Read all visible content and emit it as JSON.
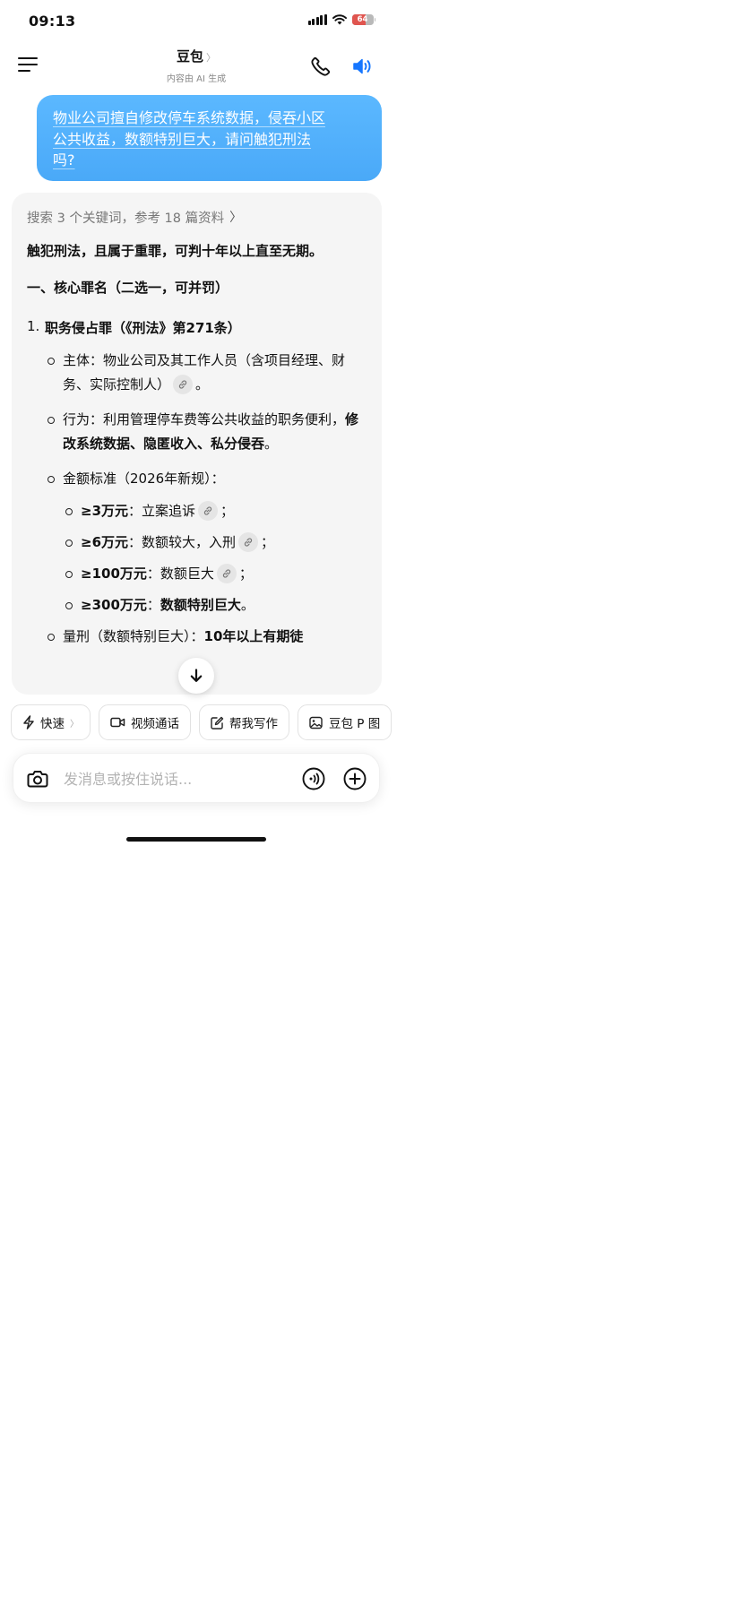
{
  "status_bar": {
    "time": "09:13",
    "battery_text": "64",
    "battery_level": 0.64
  },
  "header": {
    "title": "豆包",
    "subtitle": "内容由 AI 生成"
  },
  "user_message": {
    "line1": "物业公司擅自修改停车系统数据，侵吞小区",
    "line2": "公共收益，数额特别巨大，请问触犯刑法",
    "line3": "吗?"
  },
  "answer": {
    "sources_label": "搜索 3 个关键词，参考 18 篇资料",
    "lead": "触犯刑法，且属于重罪，可判十年以上直至无期。",
    "section1_title": "一、核心罪名（二选一，可并罚）",
    "item1_num": "1.",
    "item1_title": "职务侵占罪（《刑法》第271条）",
    "subject_text": "主体：物业公司及其工作人员（含项目经理、财务、实际控制人）",
    "subject_end": "。",
    "behavior_normal": "行为：利用管理停车费等公共收益的职务便利，",
    "behavior_bold": "修改系统数据、隐匿收入、私分侵吞",
    "behavior_end": "。",
    "standard_title": "金额标准（2026年新规）：",
    "thresholds": [
      {
        "amount": "≥3万元",
        "sep": "：",
        "desc": "立案追诉",
        "end": "；"
      },
      {
        "amount": "≥6万元",
        "sep": "：",
        "desc": "数额较大，入刑",
        "end": "；"
      },
      {
        "amount": "≥100万元",
        "sep": "：",
        "desc": "数额巨大",
        "end": "；"
      },
      {
        "amount": "≥300万元",
        "sep": "：",
        "desc": "数额特别巨大",
        "end": "。"
      }
    ],
    "sentence_normal": "量刑（数额特别巨大）：",
    "sentence_bold": "10年以上有期徒"
  },
  "quick_actions": [
    {
      "label": "快速",
      "icon": "lightning-icon"
    },
    {
      "label": "视频通话",
      "icon": "video-icon"
    },
    {
      "label": "帮我写作",
      "icon": "edit-icon"
    },
    {
      "label": "豆包 P 图",
      "icon": "image-edit-icon"
    }
  ],
  "input": {
    "placeholder": "发消息或按住说话..."
  },
  "colors": {
    "bubble": "#4aa9f8",
    "accent": "#1677ff",
    "card_bg": "#f5f5f5"
  }
}
